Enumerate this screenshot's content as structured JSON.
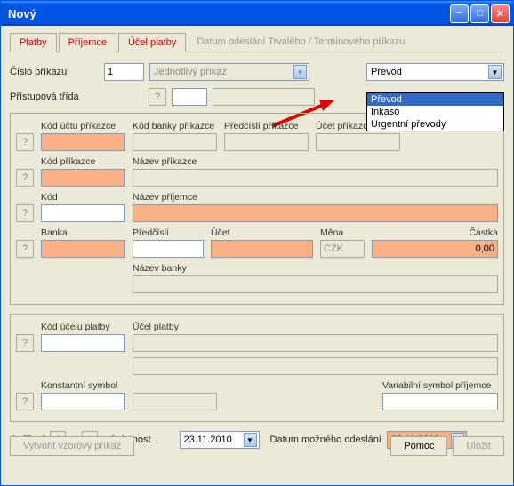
{
  "window": {
    "title": "Nový"
  },
  "tabs": {
    "t1": "Platby",
    "t2": "Příjemce",
    "t3": "Účel platby",
    "t4": "Datum odeslání Trvalého / Termínového příkazu"
  },
  "row1": {
    "label": "Číslo příkazu",
    "value": "1",
    "modeSelected": "Jednotlivý příkaz",
    "typeSelected": "Převod"
  },
  "dropdown": {
    "opt1": "Převod",
    "opt2": "Inkaso",
    "opt3": "Urgentní převody"
  },
  "row2": {
    "label": "Přístupová třída"
  },
  "group1": {
    "kodUctuPrikazce": "Kód účtu příkazce",
    "kodBankyPrikazce": "Kód banky příkazce",
    "predcisliPrikazce": "Předčíslí příkazce",
    "ucetPrikazce": "Účet příkazce",
    "kodPrikazce": "Kód příkazce",
    "nazevPrikazce": "Název příkazce",
    "kod": "Kód",
    "nazevPrijemce": "Název příjemce",
    "banka": "Banka",
    "predcisli": "Předčíslí",
    "ucet": "Účet",
    "mena": "Měna",
    "menaValue": "CZK",
    "castka": "Částka",
    "castkaValue": "0,00",
    "nazevBanky": "Název banky"
  },
  "group2": {
    "kodUceluPlatby": "Kód účelu platby",
    "ucelPlatby": "Účel platby",
    "konstSymbol": "Konstantní symbol",
    "varSymbol": "Variabilní symbol příjemce"
  },
  "bottom": {
    "overeni": "Ověření",
    "overeni1": "0",
    "z": "z",
    "overeni2": "1",
    "splatnost": "Splatnost",
    "splatnostDate": "23.11.2010",
    "datumOdeslani": "Datum možného odeslání",
    "datumOdeslaniDate": "23.11.2010"
  },
  "buttons": {
    "vytvorit": "Vytvořit vzorový příkaz",
    "pomoc": "Pomoc",
    "ulozit": "Uložit"
  },
  "help": "?"
}
